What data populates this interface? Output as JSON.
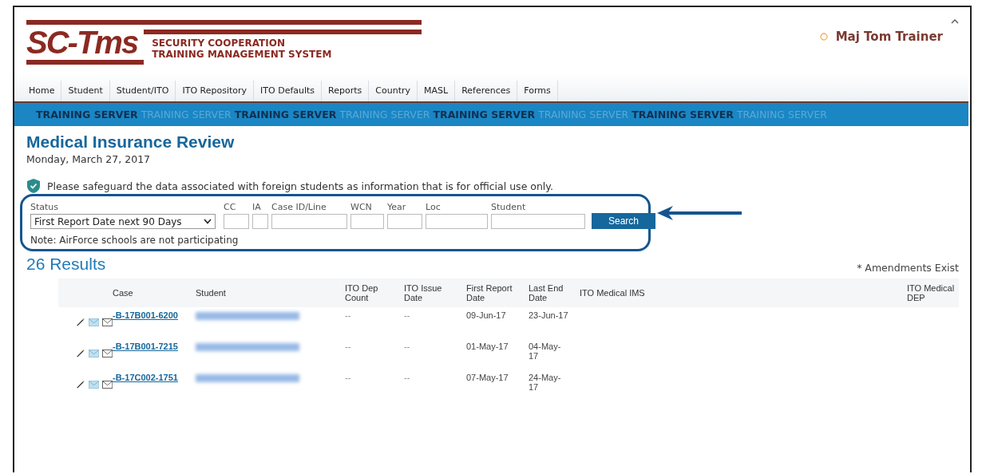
{
  "logo": {
    "mark": "SC-Tms",
    "line_1": "SECURITY COOPERATION",
    "line_2": "TRAINING MANAGEMENT SYSTEM"
  },
  "user": {
    "name": "Maj Tom Trainer"
  },
  "nav": [
    {
      "label": "Home"
    },
    {
      "label": "Student"
    },
    {
      "label": "Student/ITO"
    },
    {
      "label": "ITO Repository"
    },
    {
      "label": "ITO Defaults"
    },
    {
      "label": "Reports"
    },
    {
      "label": "Country"
    },
    {
      "label": "MASL"
    },
    {
      "label": "References"
    },
    {
      "label": "Forms"
    }
  ],
  "banner": [
    {
      "text": "TRAINING SERVER",
      "emphasis": true
    },
    {
      "text": "TRAINING SERVER",
      "emphasis": false
    },
    {
      "text": "TRAINING SERVER",
      "emphasis": true
    },
    {
      "text": "TRAINING SERVER",
      "emphasis": false
    },
    {
      "text": "TRAINING SERVER",
      "emphasis": true
    },
    {
      "text": "TRAINING SERVER",
      "emphasis": false
    },
    {
      "text": "TRAINING SERVER",
      "emphasis": true
    },
    {
      "text": "TRAINING SERVER",
      "emphasis": false
    }
  ],
  "title": "Medical Insurance Review",
  "date": "Monday, March 27, 2017",
  "notice": "Please safeguard the data associated with foreign students as information that is for official use only.",
  "filters": [
    {
      "kind": "select",
      "label": "Status",
      "value": "First Report Date next 90 Days"
    },
    {
      "kind": "text",
      "label": "CC"
    },
    {
      "kind": "text",
      "label": "IA"
    },
    {
      "kind": "text",
      "label": "Case ID/Line"
    },
    {
      "kind": "text",
      "label": "WCN"
    },
    {
      "kind": "text",
      "label": "Year"
    },
    {
      "kind": "text",
      "label": "Loc"
    },
    {
      "kind": "text",
      "label": "Student"
    }
  ],
  "search_button": "Search",
  "note": "Note: AirForce schools are not participating",
  "results": "26 Results",
  "amendments": "* Amendments Exist",
  "table": {
    "columns": [
      "Case",
      "Student",
      "ITO Dep Count",
      "ITO Issue Date",
      "First Report Date",
      "Last End Date",
      "ITO Medical IMS",
      "ITO Medical DEP"
    ],
    "rows": [
      {
        "case": "-B-17B001-6200",
        "student_redacted": true,
        "dep_count": "--",
        "issue_date": "--",
        "first_report": "09-Jun-17",
        "last_end": "23-Jun-17"
      },
      {
        "case": "-B-17B001-7215",
        "student_redacted": true,
        "dep_count": "--",
        "issue_date": "--",
        "first_report": "01-May-17",
        "last_end": "04-May-17"
      },
      {
        "case": "-B-17C002-1751",
        "student_redacted": true,
        "dep_count": "--",
        "issue_date": "--",
        "first_report": "07-May-17",
        "last_end": "24-May-17"
      }
    ]
  }
}
